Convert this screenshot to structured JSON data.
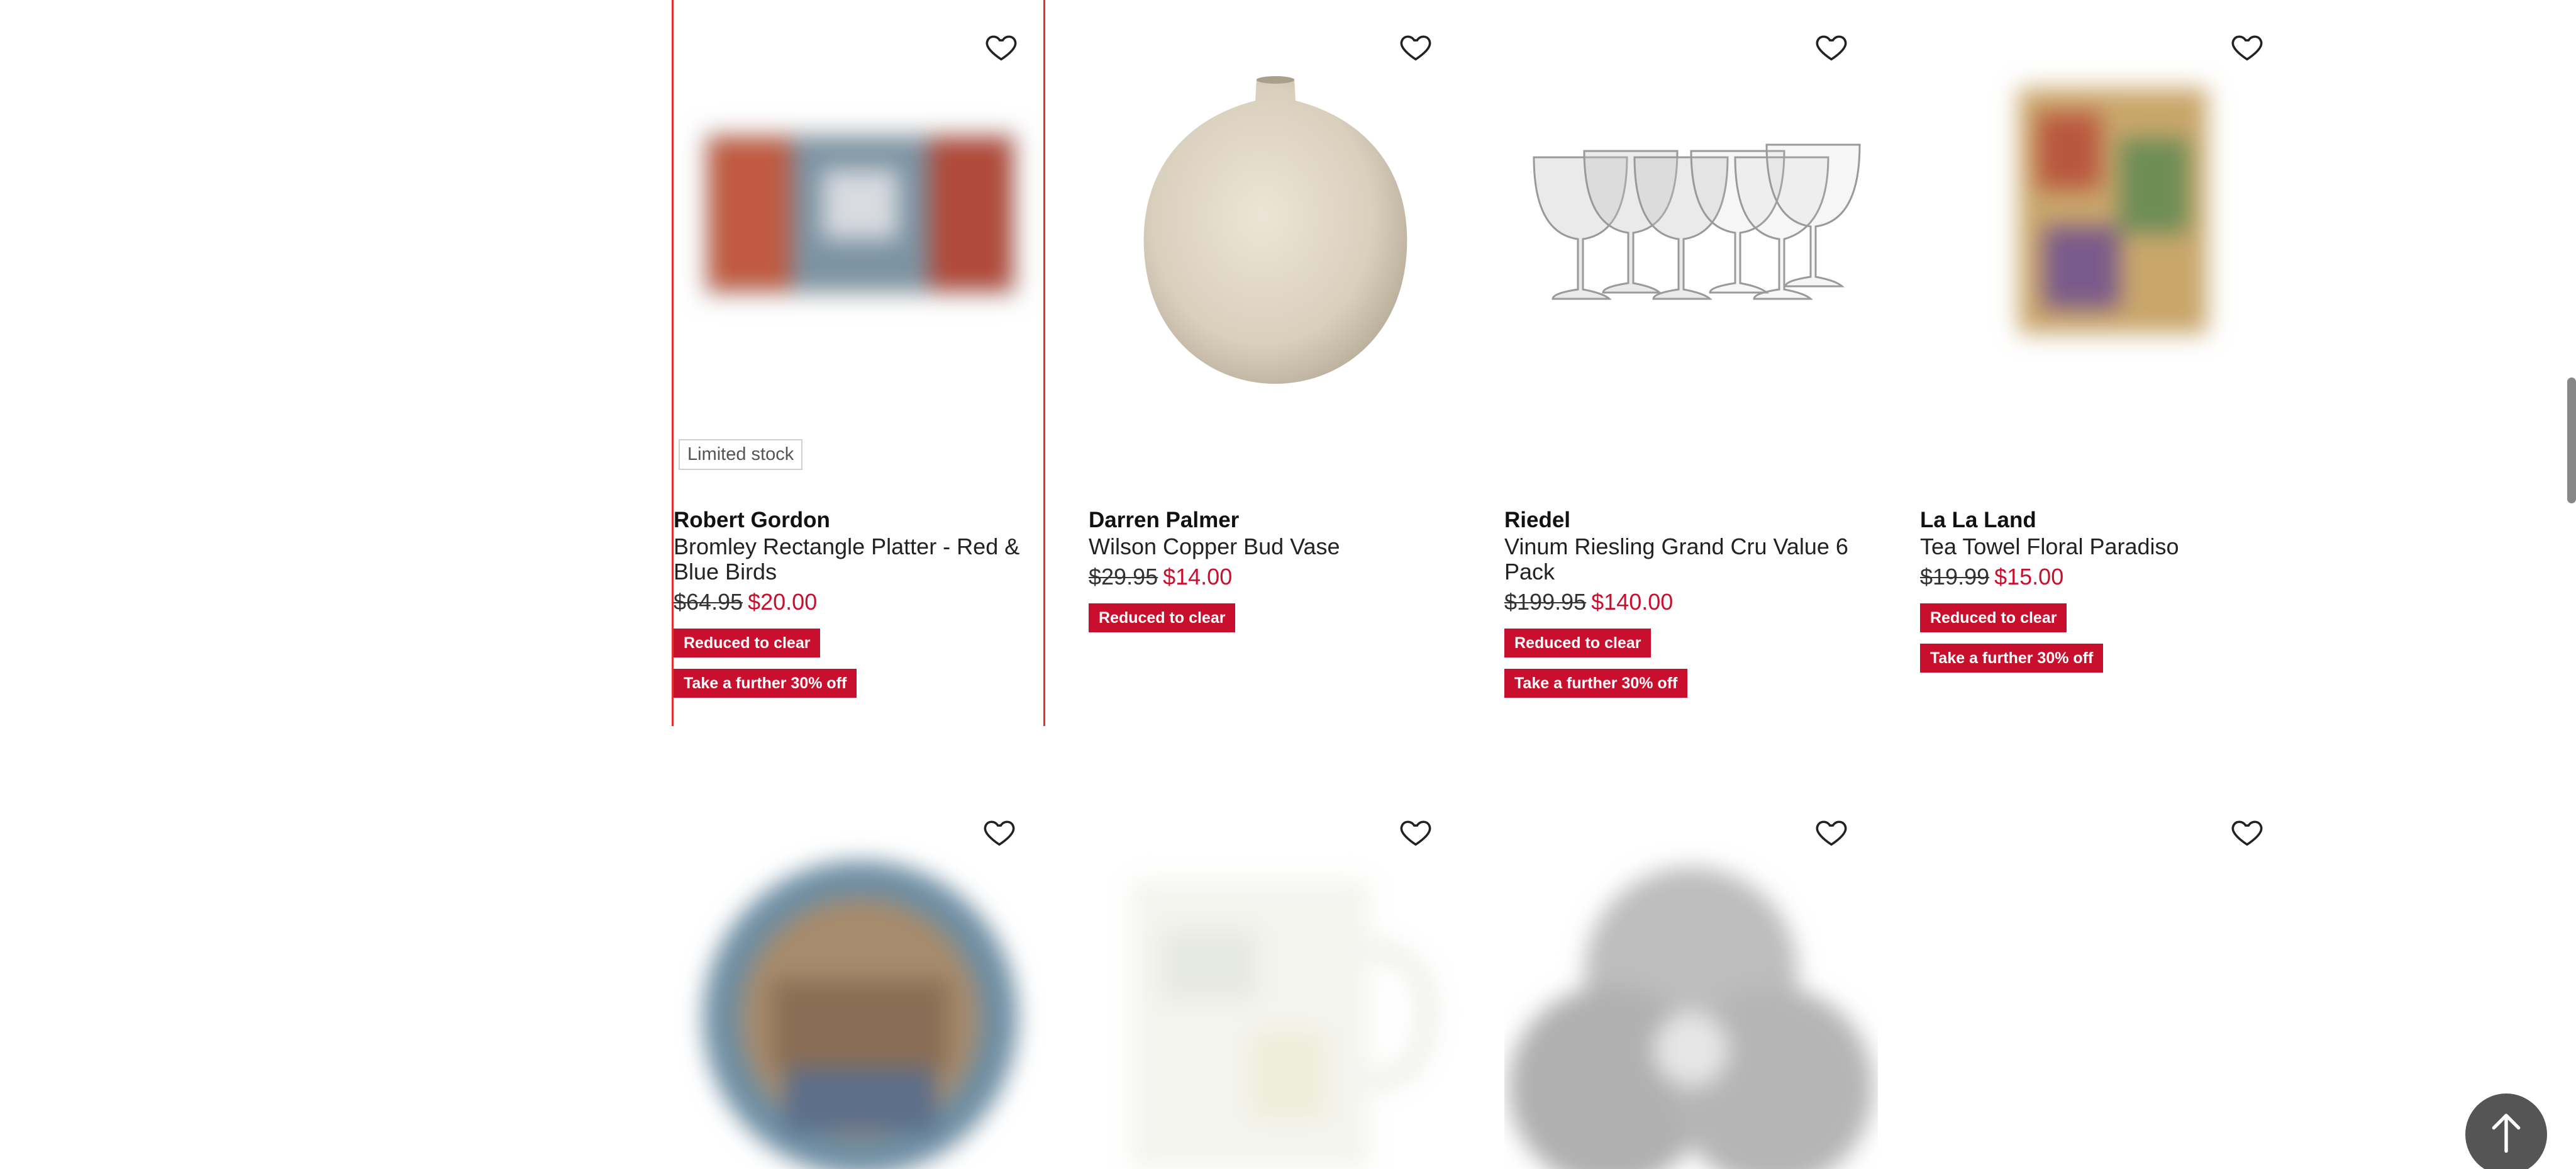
{
  "products": [
    {
      "brand": "Robert Gordon",
      "name": "Bromley Rectangle Platter - Red & Blue Birds",
      "was_price": "$64.95",
      "now_price": "$20.00",
      "badge": "Limited stock",
      "tags": [
        "Reduced to clear",
        "Take a further 30% off"
      ],
      "image_icon": "platter-image"
    },
    {
      "brand": "Darren Palmer",
      "name": "Wilson Copper Bud Vase",
      "was_price": "$29.95",
      "now_price": "$14.00",
      "tags": [
        "Reduced to clear"
      ],
      "image_icon": "vase-image"
    },
    {
      "brand": "Riedel",
      "name": "Vinum Riesling Grand Cru Value 6 Pack",
      "was_price": "$199.95",
      "now_price": "$140.00",
      "tags": [
        "Reduced to clear",
        "Take a further 30% off"
      ],
      "image_icon": "wine-glasses-image"
    },
    {
      "brand": "La La Land",
      "name": "Tea Towel Floral Paradiso",
      "was_price": "$19.99",
      "now_price": "$15.00",
      "tags": [
        "Reduced to clear",
        "Take a further 30% off"
      ],
      "image_icon": "tea-towel-image"
    }
  ],
  "second_row": [
    {
      "image_icon": "round-plate-image"
    },
    {
      "image_icon": "mug-image"
    },
    {
      "image_icon": "bowls-image"
    },
    {
      "image_icon": "blank-image"
    }
  ],
  "icons": {
    "favourite": "heart-outline-icon",
    "back_to_top": "arrow-up-icon"
  },
  "colors": {
    "sale_red": "#c8102e",
    "selected_outline": "#e03030",
    "back_to_top_bg": "#555555"
  }
}
